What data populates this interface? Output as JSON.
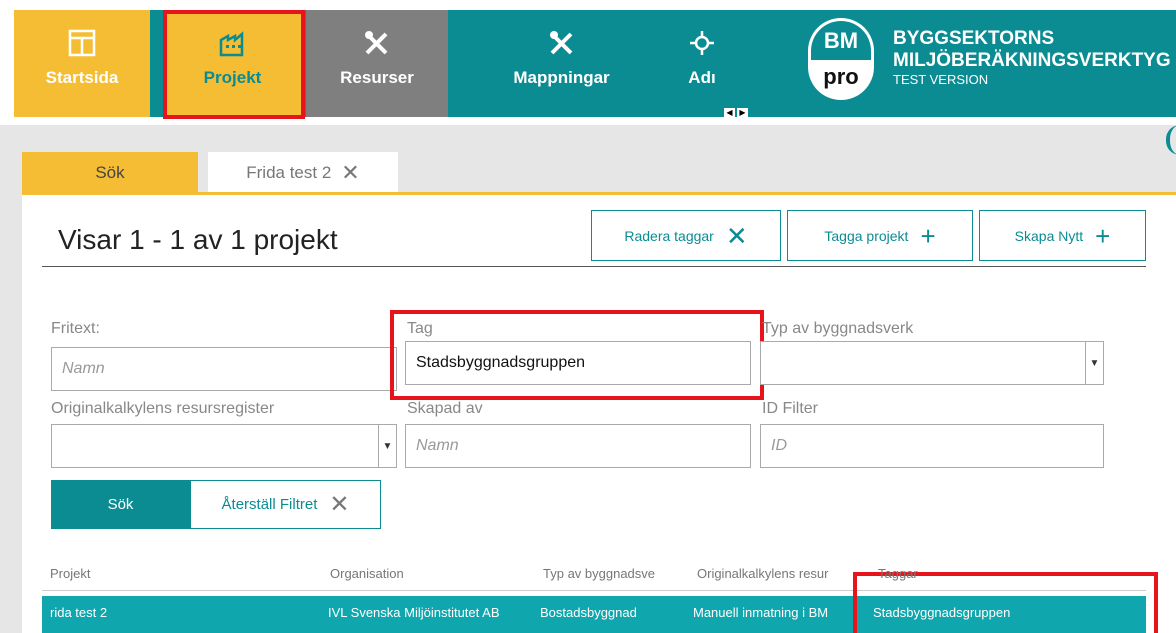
{
  "nav": {
    "items": [
      {
        "label": "Startsida"
      },
      {
        "label": "Projekt"
      },
      {
        "label": "Resurser"
      },
      {
        "label": "Mappningar"
      },
      {
        "label": "Adı"
      }
    ],
    "brand": {
      "logo_top": "BM",
      "logo_bottom": "pro",
      "line1": "BYGGSEKTORNS",
      "line2": "MILJÖBERÄKNINGSVERKTYG",
      "line3": "TEST VERSION"
    }
  },
  "tabs": {
    "search": "Sök",
    "project": "Frida test 2"
  },
  "header": {
    "title": "Visar 1 - 1 av 1 projekt",
    "buttons": {
      "delete_tags": "Radera taggar",
      "tag_project": "Tagga projekt",
      "create_new": "Skapa Nytt"
    }
  },
  "filters": {
    "fritext": {
      "label": "Fritext:",
      "placeholder": "Namn"
    },
    "tag": {
      "label": "Tag",
      "value": "Stadsbyggnadsgruppen"
    },
    "typ": {
      "label": "Typ av byggnadsverk"
    },
    "resursregister": {
      "label": "Originalkalkylens resursregister"
    },
    "skapad_av": {
      "label": "Skapad av",
      "placeholder": "Namn"
    },
    "id_filter": {
      "label": "ID Filter",
      "placeholder": "ID"
    },
    "search_button": "Sök",
    "reset_button": "Återställ Filtret"
  },
  "table": {
    "columns": [
      "Projekt",
      "Organisation",
      "Typ av byggnadsve",
      "Originalkalkylens resur",
      "Taggar"
    ],
    "rows": [
      [
        "rida test 2",
        "IVL Svenska Miljöinstitutet AB",
        "Bostadsbyggnad",
        "Manuell inmatning i BM",
        "Stadsbyggnadsgruppen"
      ]
    ]
  },
  "colors": {
    "teal": "#0b8c93",
    "yellow": "#f5bd33",
    "highlight_red": "#e8141c",
    "row_selected": "#0fa6ad"
  }
}
